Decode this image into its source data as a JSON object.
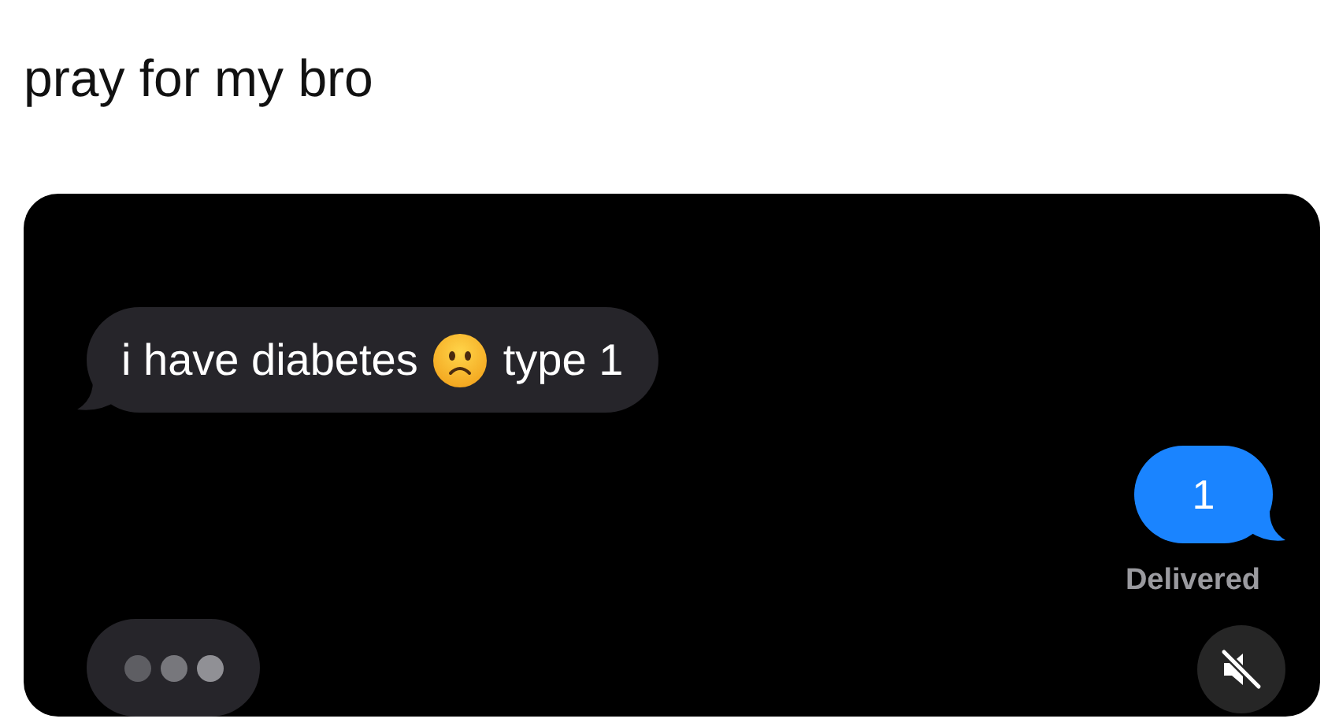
{
  "caption": "pray for my bro",
  "chat": {
    "messages": [
      {
        "kind": "incoming",
        "parts": [
          {
            "kind": "text",
            "text": "i have diabetes"
          },
          {
            "kind": "emoji"
          },
          {
            "kind": "text",
            "text": "type 1"
          }
        ]
      },
      {
        "kind": "outgoing",
        "text": "1",
        "status": "Delivered"
      },
      {
        "kind": "typing"
      }
    ],
    "muted": true
  }
}
